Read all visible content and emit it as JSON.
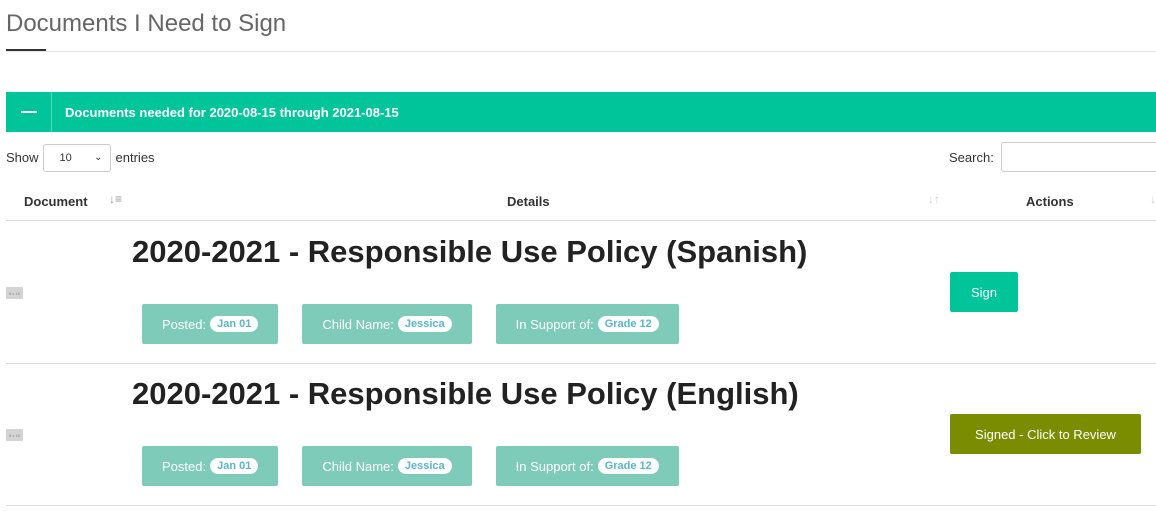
{
  "page": {
    "title": "Documents I Need to Sign"
  },
  "panel": {
    "title": "Documents needed for 2020-08-15 through 2021-08-15"
  },
  "table_controls": {
    "show_label": "Show",
    "entries_value": "10",
    "entries_label": "entries",
    "search_label": "Search:",
    "search_value": ""
  },
  "columns": {
    "document": "Document",
    "details": "Details",
    "actions": "Actions"
  },
  "rows": [
    {
      "thumb_text": "8 x 16",
      "title": "2020-2021 - Responsible Use Policy (Spanish)",
      "posted_label": "Posted:",
      "posted_value": "Jan 01",
      "child_label": "Child Name:",
      "child_value": "Jessica",
      "support_label": "In Support of:",
      "support_value": "Grade 12",
      "action_label": "Sign"
    },
    {
      "thumb_text": "8 x 16",
      "title": "2020-2021 - Responsible Use Policy (English)",
      "posted_label": "Posted:",
      "posted_value": "Jan 01",
      "child_label": "Child Name:",
      "child_value": "Jessica",
      "support_label": "In Support of:",
      "support_value": "Grade 12",
      "action_label": "Signed - Click to Review"
    }
  ],
  "colors": {
    "accent": "#00c49a",
    "tag_bg": "#7dcbb8",
    "signed_bg": "#7a8c00"
  }
}
